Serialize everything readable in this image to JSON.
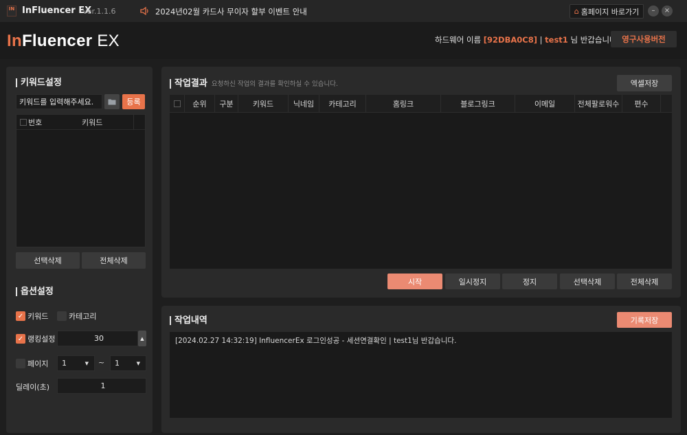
{
  "titlebar": {
    "logo_text": "IN",
    "app_name": "InFluencer EX",
    "version": "Ver.1.1.6",
    "notice": "2024년02월 카드사 무이자 할부 이벤트 안내",
    "home_button": "홈페이지 바로가기",
    "minimize": "–",
    "close": "×"
  },
  "header": {
    "brand_in": "In",
    "brand_fluencer": "Fluencer",
    "brand_ex": " EX",
    "hw_label": "하드웨어 이름",
    "hw_code": "[92DBA0C8]",
    "separator": "|",
    "username": "test1",
    "greeting": "님 반갑습니다!",
    "perm_button": "영구사용버전"
  },
  "keyword_panel": {
    "title": "키워드설정",
    "input_placeholder": "키워드를 입력해주세요.",
    "register_button": "등록",
    "columns": [
      "번호",
      "키워드"
    ],
    "delete_selected": "선택삭제",
    "delete_all": "전체삭제"
  },
  "options_panel": {
    "title": "옵션설정",
    "keyword_checkbox": "키워드",
    "category_checkbox": "카테고리",
    "ranking_label": "랭킹설정",
    "ranking_value": "30",
    "page_label": "페이지",
    "page_from": "1",
    "tilde": "~",
    "page_to": "1",
    "delay_label": "딜레이(초)",
    "delay_value": "1"
  },
  "result_panel": {
    "title": "작업결과",
    "subtitle": "요청하신 작업의 결과를 확인하실 수 있습니다.",
    "excel_button": "엑셀저장",
    "columns": [
      "순위",
      "구분",
      "키워드",
      "닉네임",
      "카테고리",
      "홈링크",
      "블로그링크",
      "이메일",
      "전체팔로워수",
      "편수"
    ],
    "start_button": "시작",
    "pause_button": "일시정지",
    "stop_button": "정지",
    "delete_selected": "선택삭제",
    "delete_all": "전체삭제"
  },
  "log_panel": {
    "title": "작업내역",
    "save_button": "기록저장",
    "entries": [
      "[2024.02.27 14:32:19]   InfluencerEx 로그인성공 - 세션연결확인  | test1님 반갑습니다."
    ]
  },
  "colors": {
    "accent": "#e8734a",
    "background": "#1e1e1e",
    "panel": "#2a2a2a"
  }
}
